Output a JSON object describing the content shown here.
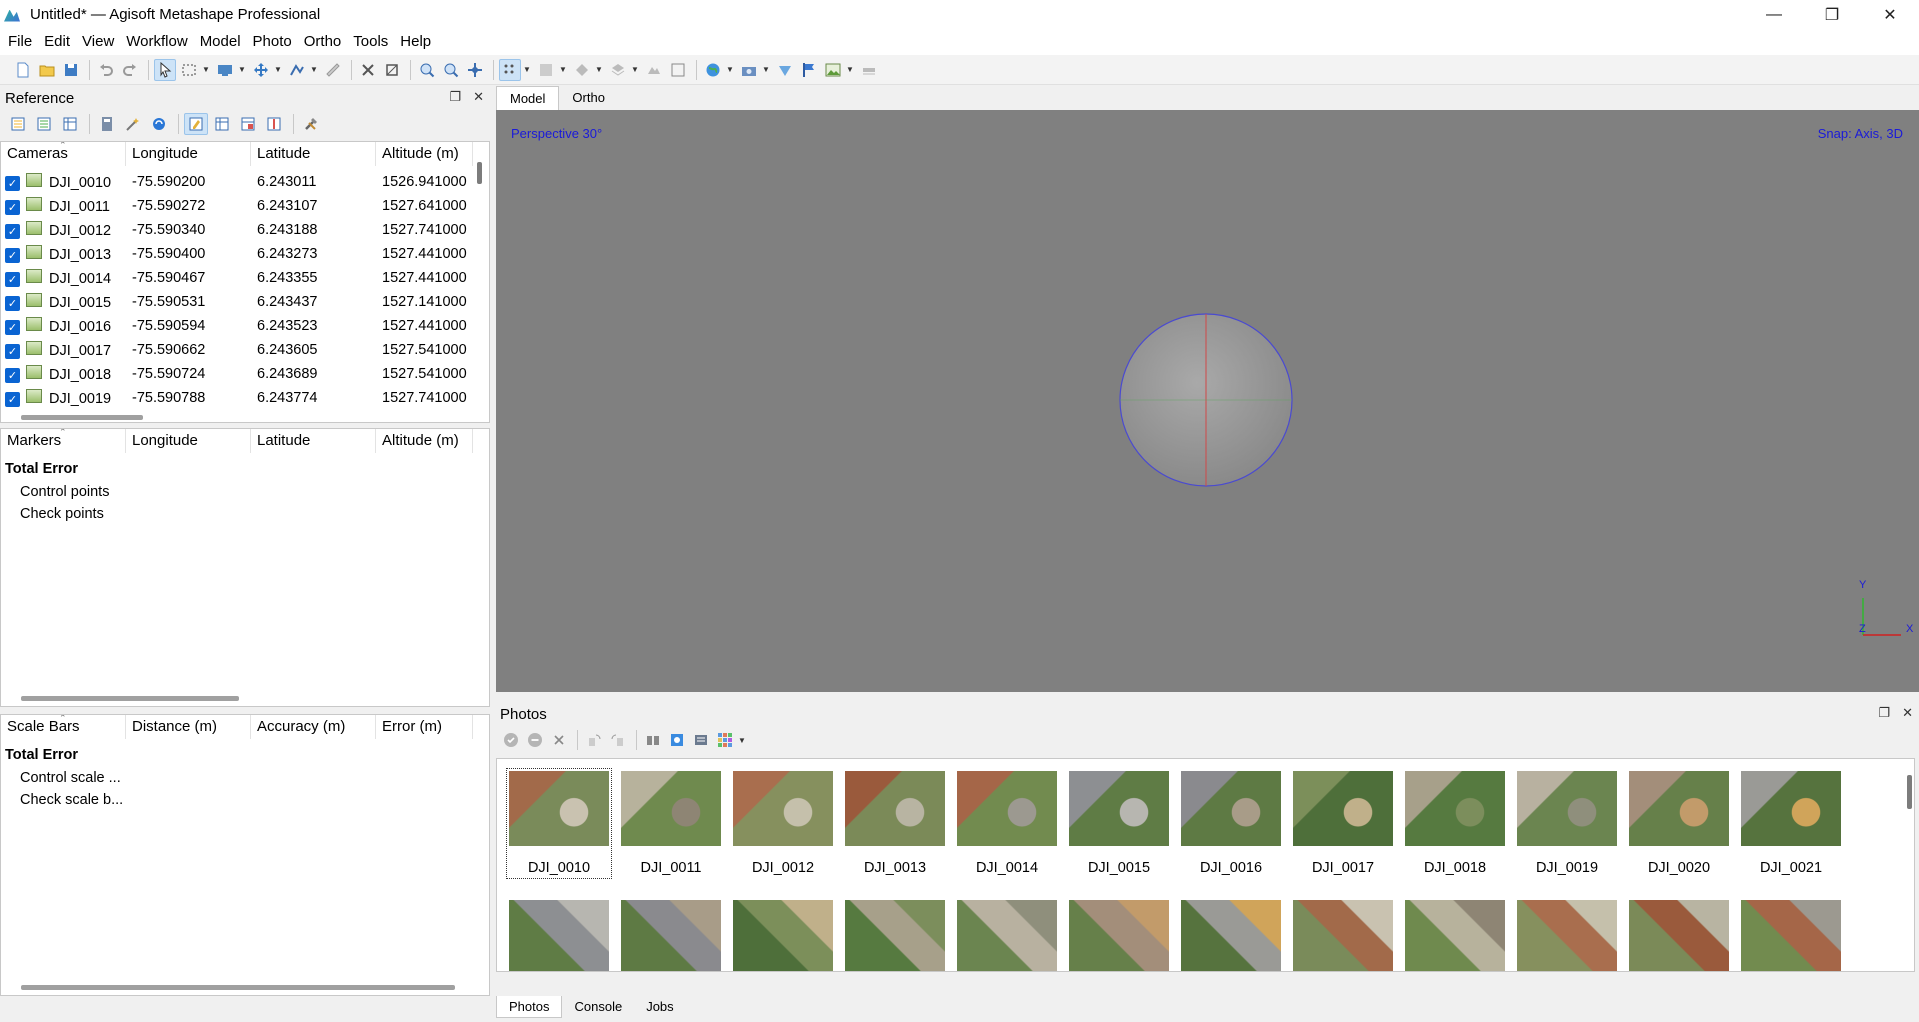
{
  "window": {
    "title": "Untitled* — Agisoft Metashape Professional"
  },
  "menu": [
    "File",
    "Edit",
    "View",
    "Workflow",
    "Model",
    "Photo",
    "Ortho",
    "Tools",
    "Help"
  ],
  "reference": {
    "title": "Reference",
    "cameras": {
      "headers": [
        "Cameras",
        "Longitude",
        "Latitude",
        "Altitude (m)"
      ],
      "rows": [
        [
          "DJI_0010",
          "-75.590200",
          "6.243011",
          "1526.941000"
        ],
        [
          "DJI_0011",
          "-75.590272",
          "6.243107",
          "1527.641000"
        ],
        [
          "DJI_0012",
          "-75.590340",
          "6.243188",
          "1527.741000"
        ],
        [
          "DJI_0013",
          "-75.590400",
          "6.243273",
          "1527.441000"
        ],
        [
          "DJI_0014",
          "-75.590467",
          "6.243355",
          "1527.441000"
        ],
        [
          "DJI_0015",
          "-75.590531",
          "6.243437",
          "1527.141000"
        ],
        [
          "DJI_0016",
          "-75.590594",
          "6.243523",
          "1527.441000"
        ],
        [
          "DJI_0017",
          "-75.590662",
          "6.243605",
          "1527.541000"
        ],
        [
          "DJI_0018",
          "-75.590724",
          "6.243689",
          "1527.541000"
        ],
        [
          "DJI_0019",
          "-75.590788",
          "6.243774",
          "1527.741000"
        ]
      ]
    },
    "markers": {
      "headers": [
        "Markers",
        "Longitude",
        "Latitude",
        "Altitude (m)"
      ],
      "total": "Total Error",
      "items": [
        "Control points",
        "Check points"
      ]
    },
    "scalebars": {
      "headers": [
        "Scale Bars",
        "Distance (m)",
        "Accuracy (m)",
        "Error (m)"
      ],
      "total": "Total Error",
      "items": [
        "Control scale ...",
        "Check scale b..."
      ]
    }
  },
  "viewport": {
    "tabs": [
      "Model",
      "Ortho"
    ],
    "projection": "Perspective 30°",
    "snap": "Snap: Axis, 3D",
    "axes": {
      "y": "Y",
      "z": "Z",
      "x": "X"
    }
  },
  "photos": {
    "title": "Photos",
    "items": [
      "DJI_0010",
      "DJI_0011",
      "DJI_0012",
      "DJI_0013",
      "DJI_0014",
      "DJI_0015",
      "DJI_0016",
      "DJI_0017",
      "DJI_0018",
      "DJI_0019",
      "DJI_0020",
      "DJI_0021"
    ],
    "bottom_tabs": [
      "Photos",
      "Console",
      "Jobs"
    ]
  },
  "colors": {
    "accent": "#0a64d2",
    "viewport_bg": "#808080",
    "label_blue": "#1a1ad9"
  }
}
